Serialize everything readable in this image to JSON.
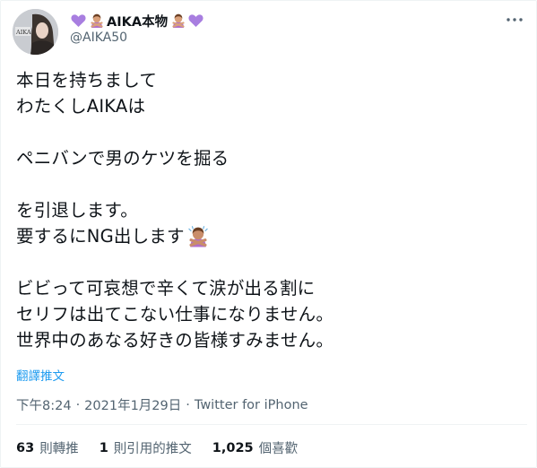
{
  "colors": {
    "accent": "#1d9bf0",
    "text_primary": "#0f1419",
    "text_secondary": "#536471",
    "heart_purple": "#a87ee0",
    "divider": "#eff3f4"
  },
  "author": {
    "avatar_label": "AIKA",
    "display_name": "AIKA本物",
    "name_icons": [
      "purple-heart-icon",
      "person-gesturing-no-icon",
      "person-gesturing-no-icon",
      "purple-heart-icon"
    ],
    "handle": "@AIKA50",
    "verified": false
  },
  "more_icon": "ellipsis-icon",
  "tweet": {
    "lines": [
      "本日を持ちまして",
      "わたくしAIKAは",
      "",
      "ペニバンで男のケツを掘る",
      "",
      "を引退します。",
      "要するにNG出します",
      "",
      "ビビって可哀想で辛くて涙が出る割に",
      "セリフは出てこない仕事になりません。",
      "世界中のあなる好きの皆様すみません。"
    ],
    "inline_emoji": "person-gesturing-no-icon",
    "translate_label": "翻譯推文"
  },
  "meta": {
    "time": "下午8:24",
    "separator": "·",
    "date": "2021年1月29日",
    "source": "Twitter for iPhone"
  },
  "stats": {
    "retweets": {
      "count": "63",
      "label": "則轉推"
    },
    "quotes": {
      "count": "1",
      "label": "則引用的推文"
    },
    "likes": {
      "count": "1,025",
      "label": "個喜歡"
    }
  }
}
